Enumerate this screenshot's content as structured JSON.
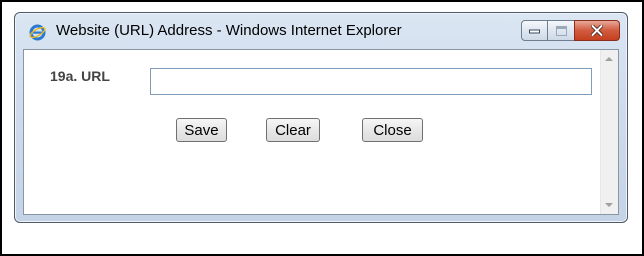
{
  "window": {
    "title": "Website (URL) Address - Windows Internet Explorer",
    "icon": "internet-explorer-icon",
    "controls": [
      "minimize-icon",
      "maximize-icon",
      "close-icon"
    ]
  },
  "form": {
    "url_label": "19a. URL",
    "url_value": "",
    "url_placeholder": ""
  },
  "buttons": {
    "save": "Save",
    "clear": "Clear",
    "close": "Close"
  },
  "colors": {
    "titlebar": "#cfdced",
    "close_button": "#d25b3f",
    "label_text": "#444444",
    "input_border": "#7f9db9"
  }
}
